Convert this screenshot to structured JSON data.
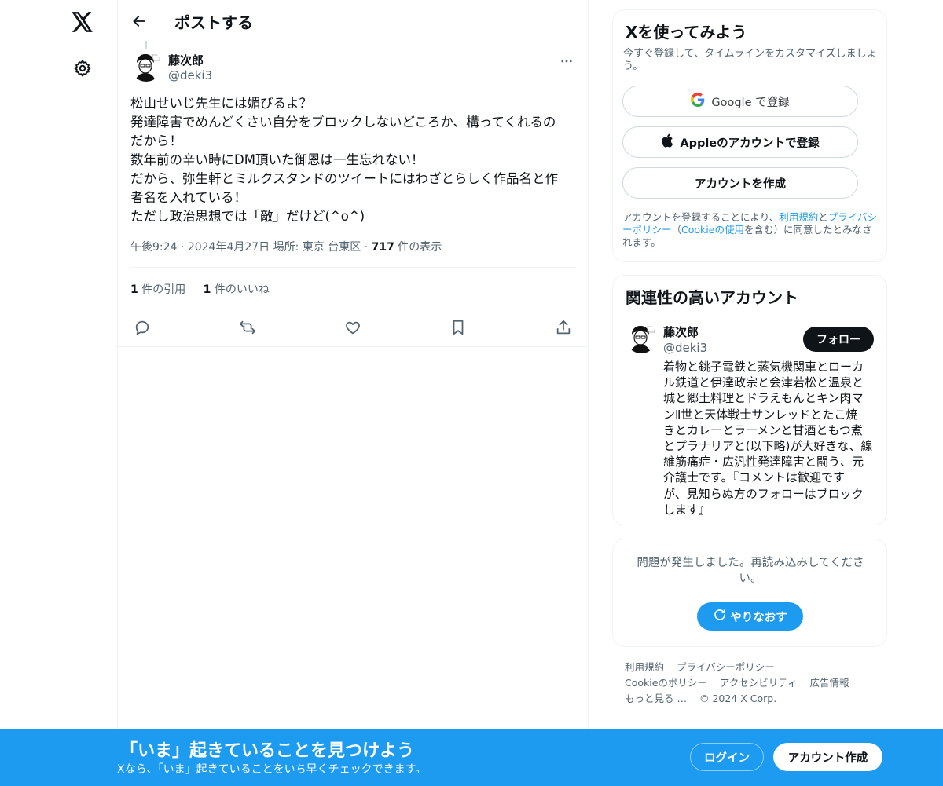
{
  "colors": {
    "accent": "#1d9bf0",
    "text": "#0f1419",
    "secondary": "#536471",
    "border": "#eff3f4"
  },
  "nav": {
    "logo_icon": "x-logo-icon",
    "settings_icon": "gear-icon"
  },
  "header": {
    "title": "ポストする",
    "back_icon": "arrow-left-icon"
  },
  "post": {
    "author_name": "藤次郎",
    "author_handle": "@deki3",
    "text_lines": [
      "松山せいじ先生には媚びるよ？",
      "発達障害でめんどくさい自分をブロックしないどころか、構ってくれるの",
      "だから！",
      "数年前の辛い時にDM頂いた御恩は一生忘れない！",
      "だから、弥生軒とミルクスタンドのツイートにはわざとらしく作品名と作",
      "者名を入れている！",
      "ただし政治思想では「敵」だけど(^o^)"
    ],
    "time": "午後9:24",
    "date": "2024年4月27日",
    "location": "場所: 東京 台東区",
    "views_count": "717",
    "views_label": " 件の表示",
    "quotes_count": "1",
    "quotes_label": " 件の引用",
    "likes_count": "1",
    "likes_label": " 件のいいね",
    "separator": "·"
  },
  "signup_card": {
    "title": "Xを使ってみよう",
    "subtitle": "今すぐ登録して、タイムラインをカスタマイズしましょう。",
    "google_label": "Google で登録",
    "apple_label": "Appleのアカウントで登録",
    "create_label": "アカウントを作成",
    "terms_prefix": "アカウントを登録することにより、",
    "terms_link": "利用規約",
    "terms_and": "と",
    "privacy_link": "プライバシーポリシー",
    "terms_paren_open": "（",
    "cookie_link": "Cookieの使用",
    "terms_suffix": "を含む）に同意したとみなされます。"
  },
  "related": {
    "title": "関連性の高いアカウント",
    "name": "藤次郎",
    "handle": "@deki3",
    "follow_label": "フォロー",
    "bio_lines": [
      "着物と銚子電鉄と蒸気機関車とローカ",
      "ル鉄道と伊達政宗と会津若松と温泉と",
      "城と郷土料理とドラえもんとキン肉マ",
      "ンⅡ世と天体戦士サンレッドとたこ焼",
      "きとカレーとラーメンと甘酒ともつ煮",
      "とプラナリアと(以下略)が大好きな、線",
      "維筋痛症・広汎性発達障害と闘う、元",
      "介護士です。『コメントは歓迎です",
      "が、見知らぬ方のフォローはブロック",
      "します』"
    ]
  },
  "error_card": {
    "message": "問題が発生しました。再読み込みしてください。",
    "retry_label": "やりなおす"
  },
  "footer": {
    "terms": "利用規約",
    "privacy": "プライバシーポリシー",
    "cookie": "Cookieのポリシー",
    "accessibility": "アクセシビリティ",
    "ads": "広告情報",
    "more": "もっと見る …",
    "copyright": "© 2024 X Corp."
  },
  "banner": {
    "title": "「いま」起きていることを見つけよう",
    "subtitle": "Xなら、「いま」起きていることをいち早くチェックできます。",
    "login_label": "ログイン",
    "signup_label": "アカウント作成"
  }
}
